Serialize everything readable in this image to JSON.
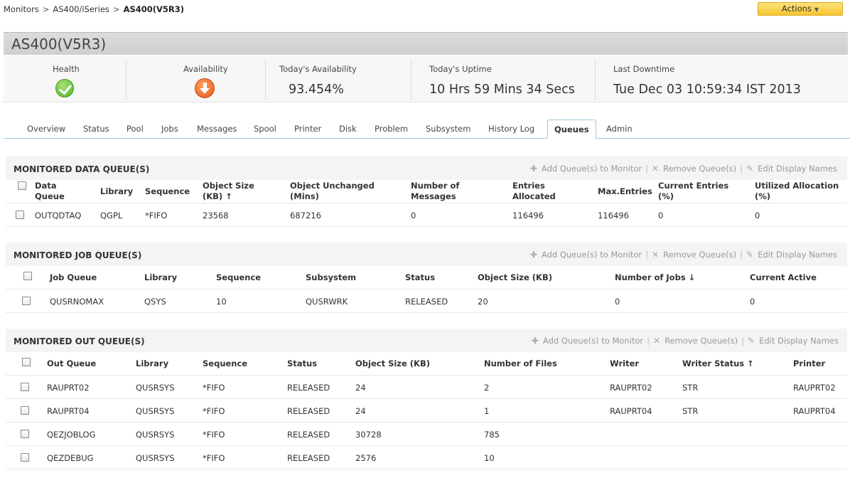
{
  "breadcrumb": {
    "item1": "Monitors",
    "item2": "AS400/iSeries",
    "current": "AS400(V5R3)",
    "sep": ">"
  },
  "actions_label": "Actions",
  "monitor_title": "AS400(V5R3)",
  "stats": {
    "health_label": "Health",
    "availability_label": "Availability",
    "today_availability_label": "Today's Availability",
    "today_availability_value": "93.454%",
    "uptime_label": "Today's Uptime",
    "uptime_value": "10 Hrs 59 Mins 34 Secs",
    "last_downtime_label": "Last Downtime",
    "last_downtime_value": "Tue Dec 03 10:59:34 IST 2013"
  },
  "tabs": [
    "Overview",
    "Status",
    "Pool",
    "Jobs",
    "Messages",
    "Spool",
    "Printer",
    "Disk",
    "Problem",
    "Subsystem",
    "History Log",
    "Queues",
    "Admin"
  ],
  "active_tab": "Queues",
  "tools": {
    "add": "Add Queue(s) to Monitor",
    "remove": "Remove Queue(s)",
    "edit": "Edit Display Names",
    "sep": "|"
  },
  "data_queue": {
    "title": "MONITORED DATA QUEUE(S)",
    "headers": {
      "name_l1": "Data",
      "name_l2": "Queue",
      "library": "Library",
      "sequence": "Sequence",
      "size_l1": "Object Size",
      "size_l2": "(KB)",
      "unchanged_l1": "Object Unchanged",
      "unchanged_l2": "(Mins)",
      "messages_l1": "Number of",
      "messages_l2": "Messages",
      "entries_l1": "Entries",
      "entries_l2": "Allocated",
      "max": "Max.Entries",
      "current_l1": "Current Entries",
      "current_l2": "(%)",
      "util_l1": "Utilized Allocation",
      "util_l2": "(%)"
    },
    "row": {
      "name": "OUTQDTAQ",
      "library": "QGPL",
      "sequence": "*FIFO",
      "size": "23568",
      "unchanged": "687216",
      "messages": "0",
      "entries": "116496",
      "max": "116496",
      "current": "0",
      "util": "0"
    }
  },
  "job_queue": {
    "title": "MONITORED JOB QUEUE(S)",
    "headers": {
      "name": "Job Queue",
      "library": "Library",
      "sequence": "Sequence",
      "subsystem": "Subsystem",
      "status": "Status",
      "size": "Object Size (KB)",
      "jobs": "Number of Jobs",
      "active": "Current Active"
    },
    "row": {
      "name": "QUSRNOMAX",
      "library": "QSYS",
      "sequence": "10",
      "subsystem": "QUSRWRK",
      "status": "RELEASED",
      "size": "20",
      "jobs": "0",
      "active": "0"
    }
  },
  "out_queue": {
    "title": "MONITORED OUT QUEUE(S)",
    "headers": {
      "name": "Out Queue",
      "library": "Library",
      "sequence": "Sequence",
      "status": "Status",
      "size": "Object Size (KB)",
      "files": "Number of Files",
      "writer": "Writer",
      "writer_status": "Writer Status",
      "printer": "Printer"
    },
    "rows": [
      {
        "name": "RAUPRT02",
        "library": "QUSRSYS",
        "sequence": "*FIFO",
        "status": "RELEASED",
        "size": "24",
        "files": "2",
        "writer": "RAUPRT02",
        "writer_status": "STR",
        "printer": "RAUPRT02"
      },
      {
        "name": "RAUPRT04",
        "library": "QUSRSYS",
        "sequence": "*FIFO",
        "status": "RELEASED",
        "size": "24",
        "files": "1",
        "writer": "RAUPRT04",
        "writer_status": "STR",
        "printer": "RAUPRT04"
      },
      {
        "name": "QEZJOBLOG",
        "library": "QUSRSYS",
        "sequence": "*FIFO",
        "status": "RELEASED",
        "size": "30728",
        "files": "785",
        "writer": "",
        "writer_status": "",
        "printer": ""
      },
      {
        "name": "QEZDEBUG",
        "library": "QUSRSYS",
        "sequence": "*FIFO",
        "status": "RELEASED",
        "size": "2576",
        "files": "10",
        "writer": "",
        "writer_status": "",
        "printer": ""
      }
    ]
  },
  "colors": {
    "accent_tab_border": "#9ec8de",
    "actions_bg": "#f7c62f",
    "health_ok": "#52b324",
    "availability_down": "#e2561a"
  },
  "icons": {
    "health": "check-circle-icon",
    "availability": "down-arrow-circle-icon"
  }
}
